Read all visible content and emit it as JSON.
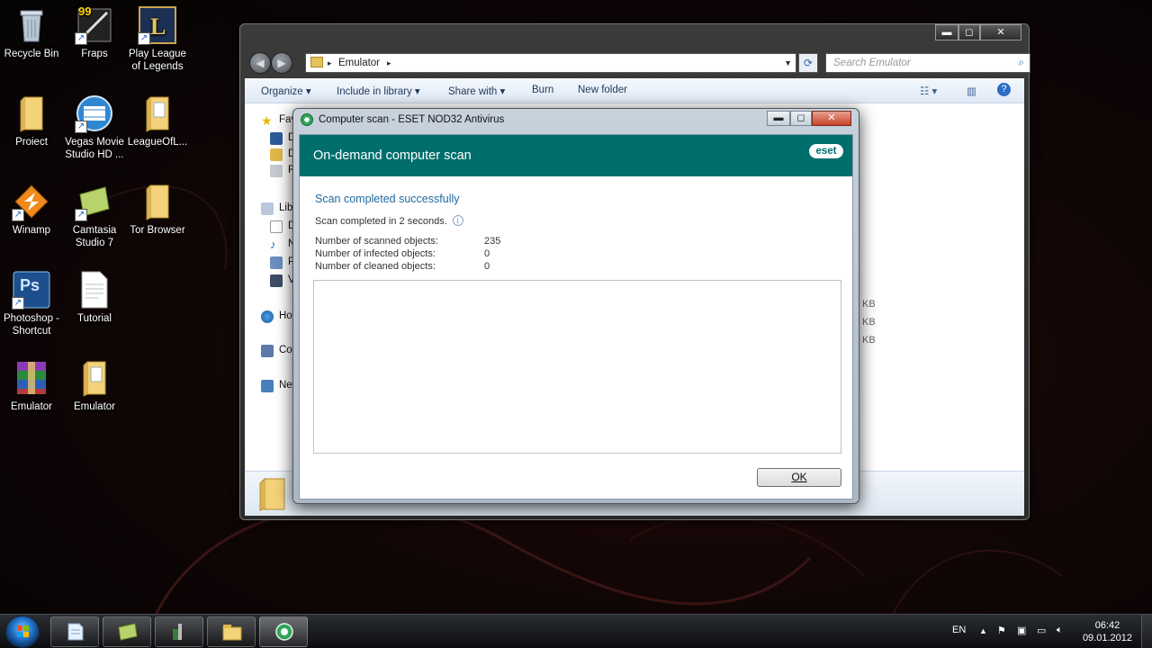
{
  "desktop_icons": [
    {
      "label": "Recycle Bin",
      "icon": "recycle-bin-icon"
    },
    {
      "label": "Fraps",
      "icon": "fraps-icon",
      "badge": "99"
    },
    {
      "label": "Play League of Legends",
      "icon": "league-of-legends-icon"
    },
    {
      "label": "Proiect",
      "icon": "folder-icon"
    },
    {
      "label": "Vegas Movie Studio HD ...",
      "icon": "vegas-movie-studio-icon"
    },
    {
      "label": "LeagueOfL...",
      "icon": "folder-icon"
    },
    {
      "label": "Winamp",
      "icon": "winamp-icon"
    },
    {
      "label": "Camtasia Studio 7",
      "icon": "camtasia-icon"
    },
    {
      "label": "Tor Browser",
      "icon": "folder-icon"
    },
    {
      "label": "Photoshop - Shortcut",
      "icon": "photoshop-icon",
      "badge": "Ps"
    },
    {
      "label": "Tutorial",
      "icon": "text-document-icon"
    },
    {
      "label": "Emulator",
      "icon": "winrar-archive-icon"
    },
    {
      "label": "Emulator",
      "icon": "folder-icon"
    }
  ],
  "explorer": {
    "controls": {
      "minimize": "▬",
      "maximize": "◻",
      "close": "✕"
    },
    "address": {
      "path": "Emulator",
      "separator": "▸"
    },
    "search_placeholder": "Search Emulator",
    "toolbar": {
      "organize": "Organize ▾",
      "include_in_library": "Include in library ▾",
      "share_with": "Share with ▾",
      "burn": "Burn",
      "new_folder": "New folder"
    },
    "nav_items": [
      {
        "label": "Fav",
        "icon": "favorites-star-icon"
      },
      {
        "label": "D",
        "icon": "desktop-icon"
      },
      {
        "label": "D",
        "icon": "downloads-icon"
      },
      {
        "label": "R",
        "icon": "recent-places-icon"
      },
      {
        "label": "Lib",
        "icon": "libraries-icon"
      },
      {
        "label": "D",
        "icon": "documents-icon"
      },
      {
        "label": "N",
        "icon": "music-icon"
      },
      {
        "label": "P",
        "icon": "pictures-icon"
      },
      {
        "label": "V",
        "icon": "videos-icon"
      },
      {
        "label": "Ho",
        "icon": "homegroup-icon"
      },
      {
        "label": "Co",
        "icon": "computer-icon"
      },
      {
        "label": "Ne",
        "icon": "network-icon"
      }
    ],
    "file_sizes": [
      "KB",
      "KB",
      "KB"
    ]
  },
  "eset": {
    "window_title": "Computer scan - ESET NOD32 Antivirus",
    "header_title": "On-demand computer scan",
    "logo": "eset",
    "status": "Scan completed successfully",
    "duration": "Scan completed in 2 seconds.",
    "stats": [
      {
        "label": "Number of scanned objects:",
        "value": "235"
      },
      {
        "label": "Number of infected objects:",
        "value": "0"
      },
      {
        "label": "Number of cleaned objects:",
        "value": "0"
      }
    ],
    "ok_label": "OK",
    "colors": {
      "header": "#006e6d",
      "status": "#1f6aa0"
    }
  },
  "taskbar": {
    "buttons": [
      {
        "name": "taskbar-documents",
        "icon": "document-icon"
      },
      {
        "name": "taskbar-camtasia",
        "icon": "camtasia-icon"
      },
      {
        "name": "taskbar-tool",
        "icon": "tool-icon"
      },
      {
        "name": "taskbar-explorer",
        "icon": "explorer-icon"
      },
      {
        "name": "taskbar-eset",
        "icon": "eset-icon"
      }
    ],
    "language": "EN",
    "time": "06:42",
    "date": "09.01.2012"
  }
}
